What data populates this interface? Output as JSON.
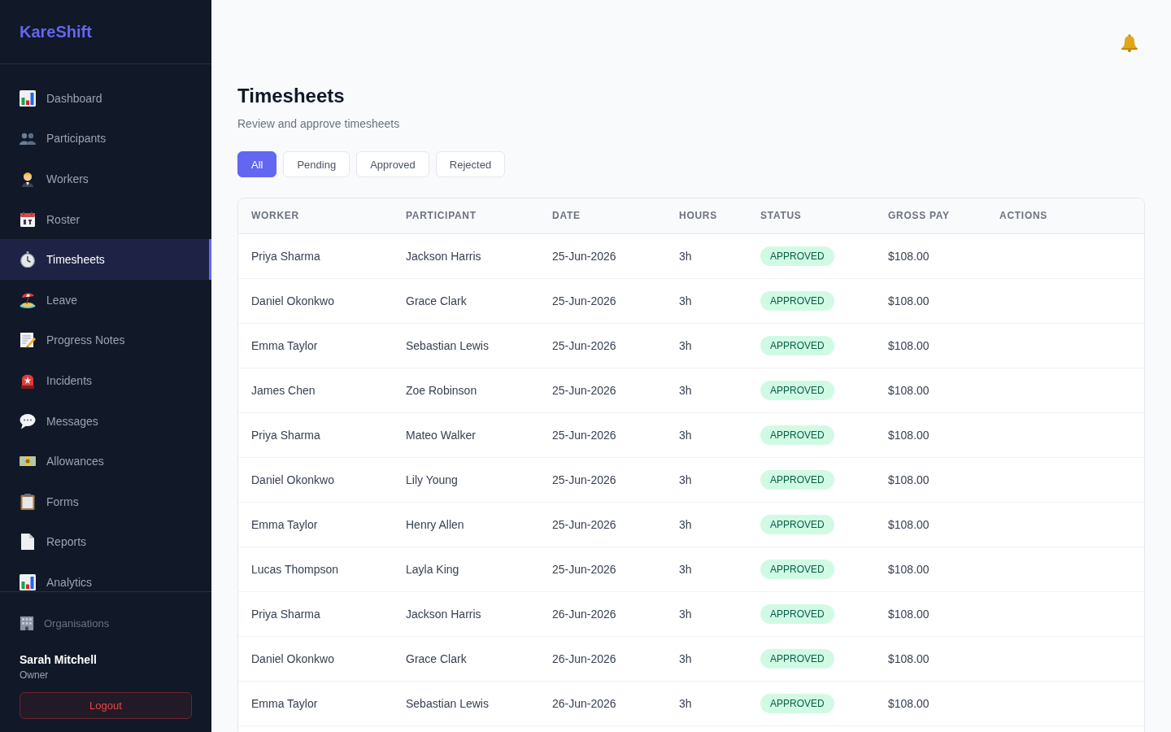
{
  "sidebar": {
    "logo": "KareShift",
    "items": [
      {
        "label": "Dashboard",
        "selected": false
      },
      {
        "label": "Participants",
        "selected": false
      },
      {
        "label": "Workers",
        "selected": false
      },
      {
        "label": "Roster",
        "selected": false
      },
      {
        "label": "Timesheets",
        "selected": true
      },
      {
        "label": "Leave",
        "selected": false
      },
      {
        "label": "Progress Notes",
        "selected": false
      },
      {
        "label": "Incidents",
        "selected": false
      },
      {
        "label": "Messages",
        "selected": false
      },
      {
        "label": "Allowances",
        "selected": false
      },
      {
        "label": "Forms",
        "selected": false
      },
      {
        "label": "Reports",
        "selected": false
      },
      {
        "label": "Analytics",
        "selected": false
      }
    ],
    "footer": {
      "organisations": "Organisations",
      "user": {
        "name": "Sarah Mitchell",
        "role": "Owner"
      },
      "logout": "Logout"
    }
  },
  "page": {
    "title": "Timesheets",
    "subtitle": "Review and approve timesheets"
  },
  "filters": [
    {
      "label": "All",
      "selected": true
    },
    {
      "label": "Pending",
      "selected": false
    },
    {
      "label": "Approved",
      "selected": false
    },
    {
      "label": "Rejected",
      "selected": false
    }
  ],
  "table": {
    "columns": [
      "WORKER",
      "PARTICIPANT",
      "DATE",
      "HOURS",
      "STATUS",
      "GROSS PAY",
      "ACTIONS"
    ],
    "rows": [
      {
        "worker": "Priya Sharma",
        "participant": "Jackson Harris",
        "date": "25-Jun-2026",
        "hours": "3h",
        "status": "APPROVED",
        "gross_pay": "$108.00"
      },
      {
        "worker": "Daniel Okonkwo",
        "participant": "Grace Clark",
        "date": "25-Jun-2026",
        "hours": "3h",
        "status": "APPROVED",
        "gross_pay": "$108.00"
      },
      {
        "worker": "Emma Taylor",
        "participant": "Sebastian Lewis",
        "date": "25-Jun-2026",
        "hours": "3h",
        "status": "APPROVED",
        "gross_pay": "$108.00"
      },
      {
        "worker": "James Chen",
        "participant": "Zoe Robinson",
        "date": "25-Jun-2026",
        "hours": "3h",
        "status": "APPROVED",
        "gross_pay": "$108.00"
      },
      {
        "worker": "Priya Sharma",
        "participant": "Mateo Walker",
        "date": "25-Jun-2026",
        "hours": "3h",
        "status": "APPROVED",
        "gross_pay": "$108.00"
      },
      {
        "worker": "Daniel Okonkwo",
        "participant": "Lily Young",
        "date": "25-Jun-2026",
        "hours": "3h",
        "status": "APPROVED",
        "gross_pay": "$108.00"
      },
      {
        "worker": "Emma Taylor",
        "participant": "Henry Allen",
        "date": "25-Jun-2026",
        "hours": "3h",
        "status": "APPROVED",
        "gross_pay": "$108.00"
      },
      {
        "worker": "Lucas Thompson",
        "participant": "Layla King",
        "date": "25-Jun-2026",
        "hours": "3h",
        "status": "APPROVED",
        "gross_pay": "$108.00"
      },
      {
        "worker": "Priya Sharma",
        "participant": "Jackson Harris",
        "date": "26-Jun-2026",
        "hours": "3h",
        "status": "APPROVED",
        "gross_pay": "$108.00"
      },
      {
        "worker": "Daniel Okonkwo",
        "participant": "Grace Clark",
        "date": "26-Jun-2026",
        "hours": "3h",
        "status": "APPROVED",
        "gross_pay": "$108.00"
      },
      {
        "worker": "Emma Taylor",
        "participant": "Sebastian Lewis",
        "date": "26-Jun-2026",
        "hours": "3h",
        "status": "APPROVED",
        "gross_pay": "$108.00"
      }
    ]
  }
}
